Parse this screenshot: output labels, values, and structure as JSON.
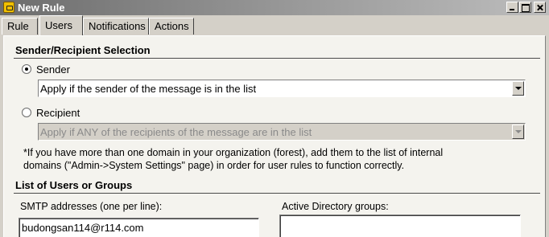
{
  "window": {
    "title": "New Rule"
  },
  "tabs": [
    {
      "label": "Rule"
    },
    {
      "label": "Users"
    },
    {
      "label": "Notifications"
    },
    {
      "label": "Actions"
    }
  ],
  "active_tab": "Users",
  "sender_recipient": {
    "heading": "Sender/Recipient Selection",
    "sender_option": {
      "label": "Sender",
      "checked": true
    },
    "sender_combo": {
      "value": "Apply if the sender of the message is in the list",
      "enabled": true
    },
    "recipient_option": {
      "label": "Recipient",
      "checked": false
    },
    "recipient_combo": {
      "value": "Apply if ANY of the recipients of the message are in the list",
      "enabled": false
    }
  },
  "note": {
    "line1": "*If you have more than one domain in your organization (forest), add them to the list of internal",
    "line2": "domains (\"Admin->System Settings\" page) in order for user rules to function correctly."
  },
  "users_groups": {
    "heading": "List of Users or Groups",
    "smtp_label": "SMTP addresses (one per line):",
    "smtp_value": "budongsan114@r114.com",
    "ad_label": "Active Directory groups:",
    "ad_value": ""
  }
}
